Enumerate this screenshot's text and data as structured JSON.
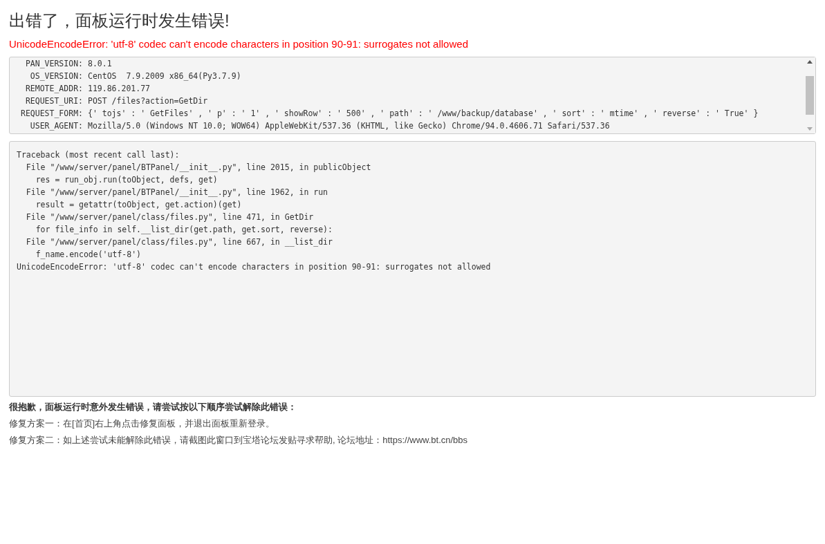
{
  "title": "出错了，面板运行时发生错误!",
  "error_message": "UnicodeEncodeError: 'utf-8' codec can't encode characters in position 90-91: surrogates not allowed",
  "environment": [
    {
      "key": "PAN_VERSION:",
      "value": "8.0.1"
    },
    {
      "key": "OS_VERSION:",
      "value": "CentOS  7.9.2009 x86_64(Py3.7.9)"
    },
    {
      "key": "REMOTE_ADDR:",
      "value": "119.86.201.77"
    },
    {
      "key": "REQUEST_URI:",
      "value": "POST /files?action=GetDir"
    },
    {
      "key": "REQUEST_FORM:",
      "value": "{' tojs' : ' GetFiles' , ' p' : ' 1' , ' showRow' : ' 500' , ' path' : ' /www/backup/database' , ' sort' : ' mtime' , ' reverse' : ' True' }"
    },
    {
      "key": "USER_AGENT:",
      "value": "Mozilla/5.0 (Windows NT 10.0; WOW64) AppleWebKit/537.36 (KHTML, like Gecko) Chrome/94.0.4606.71 Safari/537.36"
    }
  ],
  "traceback": [
    "Traceback (most recent call last):",
    "  File \"/www/server/panel/BTPanel/__init__.py\", line 2015, in publicObject",
    "    res = run_obj.run(toObject, defs, get)",
    "  File \"/www/server/panel/BTPanel/__init__.py\", line 1962, in run",
    "    result = getattr(toObject, get.action)(get)",
    "  File \"/www/server/panel/class/files.py\", line 471, in GetDir",
    "    for file_info in self.__list_dir(get.path, get.sort, reverse):",
    "  File \"/www/server/panel/class/files.py\", line 667, in __list_dir",
    "    f_name.encode('utf-8')",
    "UnicodeEncodeError: 'utf-8' codec can't encode characters in position 90-91: surrogates not allowed"
  ],
  "help_heading": "很抱歉，面板运行时意外发生错误，请尝试按以下顺序尝试解除此错误：",
  "help_steps": [
    "修复方案一：在[首页]右上角点击修复面板，并退出面板重新登录。",
    "修复方案二：如上述尝试未能解除此错误，请截图此窗口到宝塔论坛发贴寻求帮助, 论坛地址：https://www.bt.cn/bbs"
  ]
}
